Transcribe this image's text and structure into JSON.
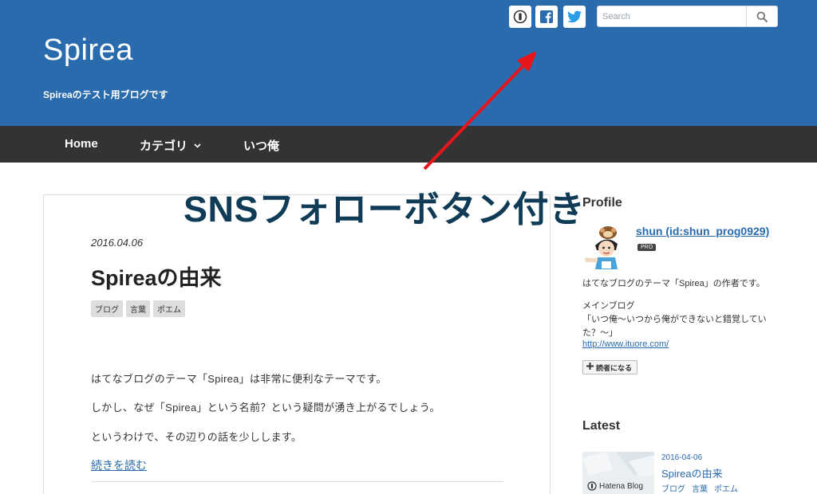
{
  "header": {
    "site_title": "Spirea",
    "tagline": "Spireaのテスト用ブログです",
    "sns": {
      "hatena_icon": "hatena-bookmark-icon",
      "facebook_icon": "facebook-icon",
      "twitter_icon": "twitter-icon"
    },
    "search": {
      "placeholder": "Search",
      "icon": "search-icon"
    },
    "colors": {
      "background": "#2a6bad"
    }
  },
  "nav": {
    "items": [
      {
        "label": "Home"
      },
      {
        "label": "カテゴリ"
      },
      {
        "label": "いつ俺"
      }
    ],
    "colors": {
      "background": "#333333"
    }
  },
  "annotation": {
    "text": "SNSフォローボタン付き",
    "arrow_color": "#e8151b",
    "text_color": "#0f3b57"
  },
  "article": {
    "date": "2016.04.06",
    "title": "Spireaの由来",
    "tags": [
      "ブログ",
      "言葉",
      "ポエム"
    ],
    "paragraphs": [
      "はてなブログのテーマ「Spirea」は非常に便利なテーマです。",
      "しかし、なぜ「Spirea」という名前？という疑問が湧き上がるでしょう。",
      "というわけで、その辺りの話を少しします。"
    ],
    "read_more": "続きを読む"
  },
  "sidebar": {
    "profile": {
      "heading": "Profile",
      "name": "shun (id:shun_prog0929)",
      "badge": "PRO",
      "description": "はてなブログのテーマ「Spirea」の作者です。",
      "main_blog_label": "メインブログ",
      "main_blog_title": "「いつ俺〜いつから俺ができないと錯覚していた？〜」",
      "url": "http://www.ituore.com/",
      "follow_button": "読者になる"
    },
    "latest": {
      "heading": "Latest",
      "items": [
        {
          "thumbnail_label": "Hatena Blog",
          "date": "2016-04-06",
          "title": "Spireaの由来",
          "tags": [
            "ブログ",
            "言葉",
            "ポエム"
          ]
        }
      ]
    }
  }
}
